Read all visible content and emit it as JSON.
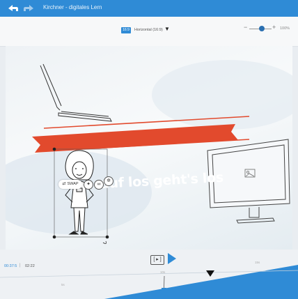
{
  "header": {
    "title": "Kirchner - digitales Lern"
  },
  "toolbar": {
    "orientation_badge": "16:9",
    "orientation_label": "Horizontal (16:9)",
    "zoom_value": "100%",
    "zoom_minus": "−",
    "zoom_plus": "+"
  },
  "canvas": {
    "banner_text": "auf los geht's los",
    "swap_label": "SWAP"
  },
  "timeline": {
    "play_label": "[ ▸ ]",
    "current_time": "00:37:5",
    "separator": "|",
    "total_time": "02:22",
    "ticks": [
      "5s",
      "10s",
      "15s"
    ]
  },
  "colors": {
    "topbar": "#2f8bd6",
    "banner": "#e24a2d",
    "accent": "#2f8bd6"
  },
  "icons": [
    "back-arrow-icon",
    "redo-icon",
    "play-icon",
    "swap-icon",
    "walk-icon",
    "bike-icon",
    "settings-icon",
    "image-placeholder-icon",
    "playhead-marker-icon"
  ]
}
